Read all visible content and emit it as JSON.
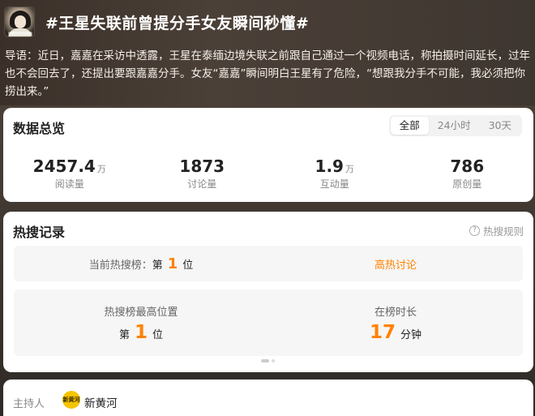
{
  "header": {
    "title": "#王星失联前曾提分手女友瞬间秒懂#",
    "intro": "导语：近日，嘉嘉在采访中透露，王星在泰缅边境失联之前跟自己通过一个视频电话，称拍摄时间延长，过年也不会回去了，还提出要跟嘉嘉分手。女友“嘉嘉”瞬间明白王星有了危险，“想跟我分手不可能，我必须把你捞出来。”"
  },
  "overview": {
    "title": "数据总览",
    "tabs": [
      "全部",
      "24小时",
      "30天"
    ],
    "active_tab": "全部",
    "stats": [
      {
        "value": "2457.4",
        "unit": "万",
        "label": "阅读量"
      },
      {
        "value": "1873",
        "unit": "",
        "label": "讨论量"
      },
      {
        "value": "1.9",
        "unit": "万",
        "label": "互动量"
      },
      {
        "value": "786",
        "unit": "",
        "label": "原创量"
      }
    ]
  },
  "hot": {
    "title": "热搜记录",
    "rule_label": "热搜规则",
    "current_label": "当前热搜榜：",
    "current_prefix": "第",
    "current_rank": "1",
    "current_suffix": "位",
    "current_tag": "高热讨论",
    "best_label": "热搜榜最高位置",
    "best_prefix": "第",
    "best_rank": "1",
    "best_suffix": "位",
    "duration_label": "在榜时长",
    "duration_value": "17",
    "duration_unit": "分钟"
  },
  "host": {
    "label": "主持人",
    "logo_text": "新黄河",
    "name": "新黄河"
  },
  "colors": {
    "accent": "#ff8200"
  }
}
